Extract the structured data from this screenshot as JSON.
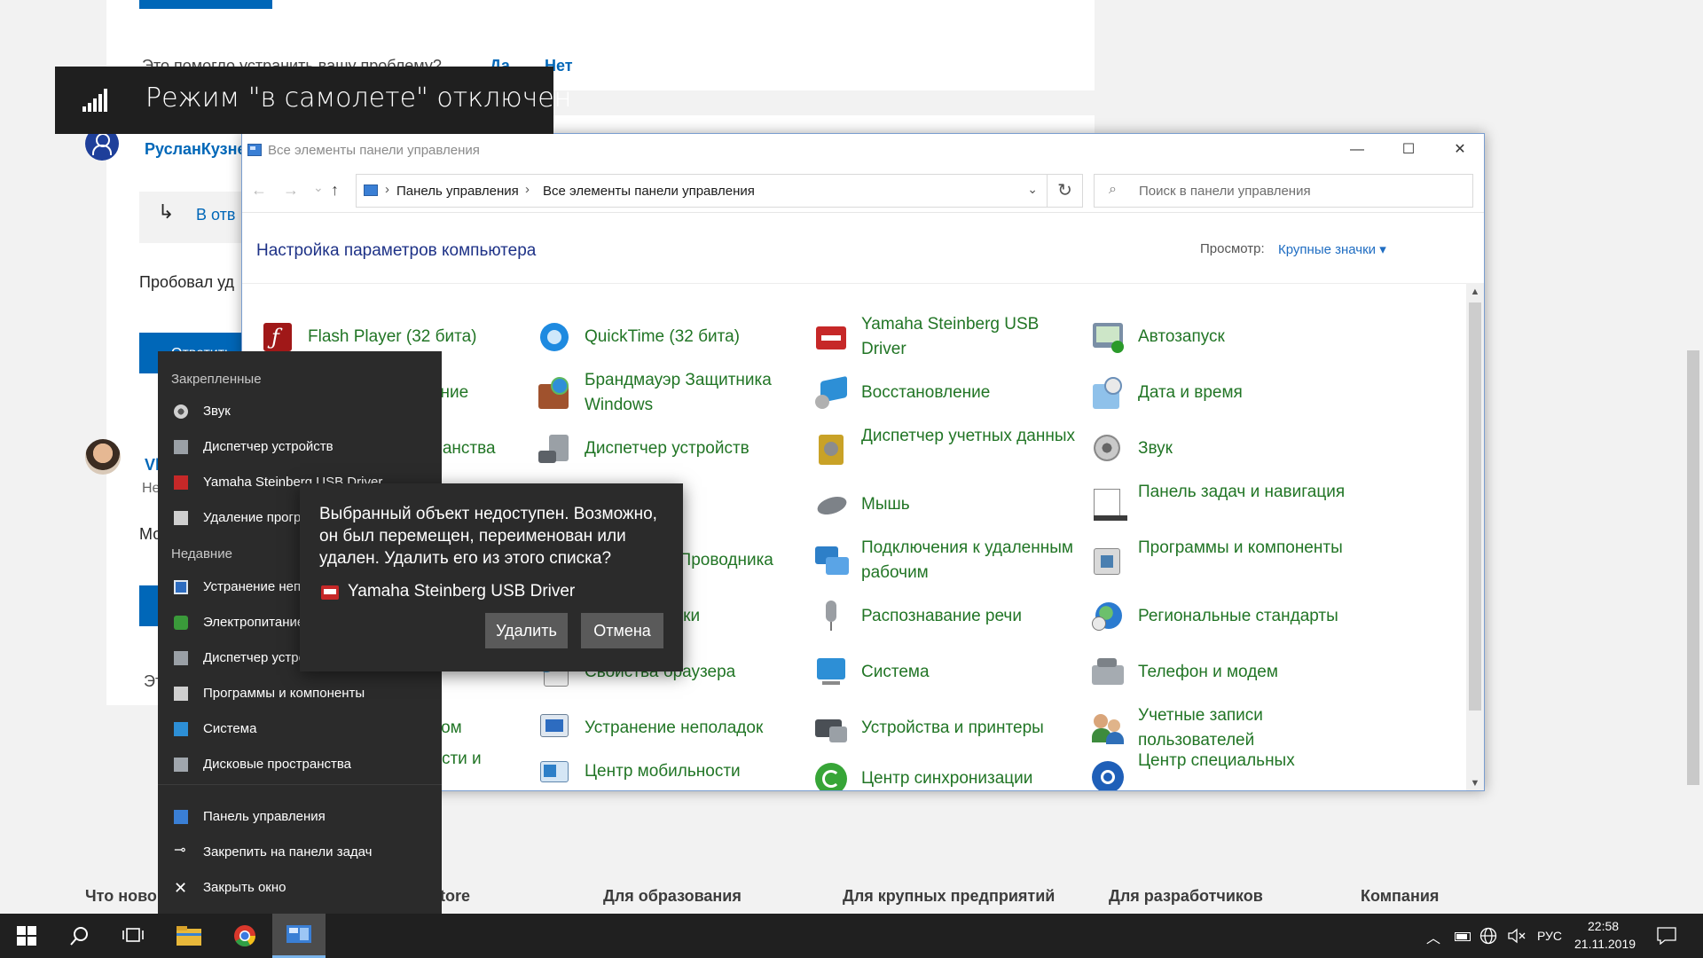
{
  "background_page": {
    "feedback_question": "Это помогло устранить вашу проблему?",
    "feedback_yes": "Да",
    "feedback_no": "Нет",
    "user_name": "РусланКузне",
    "reply_label": "В отв",
    "post_text": "Пробовал уд",
    "reply_button": "Ответить",
    "user2_name": "Vl",
    "user2_sub": "Не",
    "post2_text": "Мо",
    "footer2_partial": "Эт",
    "footer_links": [
      "Что ново",
      "tore",
      "Для образования",
      "Для крупных предприятий",
      "Для разработчиков",
      "Компания"
    ]
  },
  "airplane_toast": {
    "text": "Режим \"в самолете\" отключен",
    "icon": "signal-bars-icon"
  },
  "window": {
    "title": "Все элементы панели управления",
    "minimize": "—",
    "maximize": "☐",
    "close": "✕",
    "nav_back": "←",
    "nav_forward": "→",
    "nav_recent": "⌄",
    "nav_up": "↑",
    "breadcrumb": [
      "Панель управления",
      "Все элементы панели управления"
    ],
    "search_placeholder": "Поиск в панели управления",
    "heading": "Настройка параметров компьютера",
    "view_label": "Просмотр:",
    "view_value": "Крупные значки ▾",
    "items": [
      {
        "label": "Flash Player (32 бита)",
        "icon": "flash-player-icon"
      },
      {
        "label": "QuickTime (32 бита)",
        "icon": "quicktime-icon"
      },
      {
        "label": "Yamaha Steinberg USB Driver",
        "icon": "usb-driver-icon"
      },
      {
        "label": "Автозапуск",
        "icon": "autoplay-icon"
      },
      {
        "label": "Администрирование",
        "icon": "admin-tools-icon"
      },
      {
        "label": "Брандмауэр Защитника Windows",
        "icon": "firewall-icon"
      },
      {
        "label": "Восстановление",
        "icon": "recovery-icon"
      },
      {
        "label": "Дата и время",
        "icon": "date-time-icon"
      },
      {
        "label": "Дисковые пространства",
        "icon": "storage-spaces-icon"
      },
      {
        "label": "Диспетчер устройств",
        "icon": "device-manager-icon"
      },
      {
        "label": "Диспетчер учетных данных",
        "icon": "credential-manager-icon"
      },
      {
        "label": "Звук",
        "icon": "sound-icon"
      },
      {
        "label": "Мышь",
        "icon": "mouse-icon"
      },
      {
        "label": "Панель задач и навигация",
        "icon": "taskbar-nav-icon"
      },
      {
        "label": "Параметры Проводника",
        "icon": "explorer-options-icon"
      },
      {
        "label": "Подключения к удаленным рабочим",
        "icon": "remote-desktop-icon"
      },
      {
        "label": "Программы и компоненты",
        "icon": "programs-icon"
      },
      {
        "label": "Распознавание речи",
        "icon": "speech-icon"
      },
      {
        "label": "Региональные стандарты",
        "icon": "region-icon"
      },
      {
        "label": "Рабочие папки",
        "icon": "work-folders-icon"
      },
      {
        "label": "Свойства браузера",
        "icon": "internet-options-icon"
      },
      {
        "label": "Система",
        "icon": "system-icon"
      },
      {
        "label": "Телефон и модем",
        "icon": "phone-modem-icon"
      },
      {
        "label": "Управление цветом",
        "icon": "color-management-icon"
      },
      {
        "label": "Устранение неполадок",
        "icon": "troubleshooting-icon"
      },
      {
        "label": "Устройства и принтеры",
        "icon": "devices-printers-icon"
      },
      {
        "label": "Учетные записи пользователей",
        "icon": "user-accounts-icon"
      },
      {
        "label": "Центр безопасности и обслуживания",
        "icon": "security-center-icon"
      },
      {
        "label": "Центр мобильности",
        "icon": "mobility-center-icon"
      },
      {
        "label": "Центр синхронизации",
        "icon": "sync-center-icon"
      },
      {
        "label": "Центр специальных",
        "icon": "ease-of-access-icon"
      }
    ]
  },
  "jumplist": {
    "pinned_header": "Закрепленные",
    "pinned": [
      "Звук",
      "Диспетчер устройств",
      "Yamaha Steinberg USB Driver",
      "Удаление програ"
    ],
    "recent_header": "Недавние",
    "recent": [
      "Устранение непо",
      "Электропитание",
      "Диспетчер устро",
      "Программы и компоненты",
      "Система",
      "Дисковые пространства"
    ],
    "tasks": [
      "Панель управления",
      "Закрепить на панели задач",
      "Закрыть окно"
    ]
  },
  "dialog": {
    "message": "Выбранный объект недоступен. Возможно, он был перемещен, переименован или удален. Удалить его из этого списка?",
    "item": "Yamaha Steinberg USB Driver",
    "delete_button": "Удалить",
    "cancel_button": "Отмена"
  },
  "taskbar": {
    "language": "РУС",
    "time": "22:58",
    "date": "21.11.2019"
  }
}
